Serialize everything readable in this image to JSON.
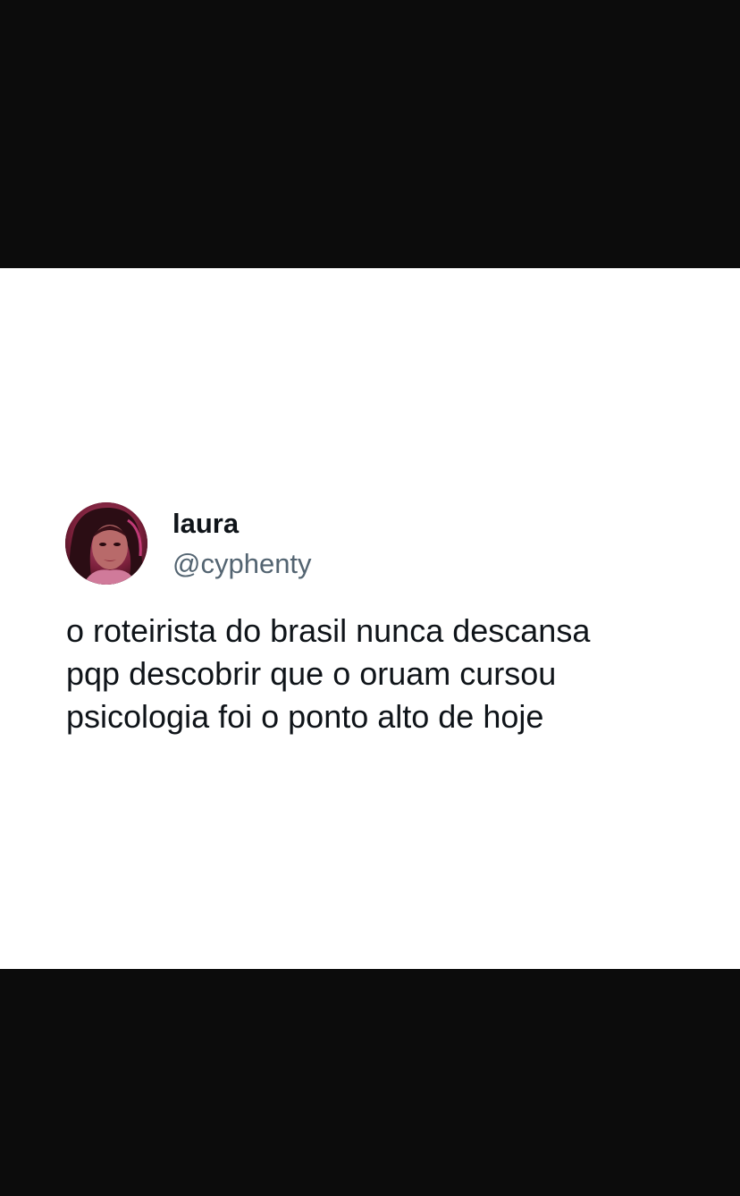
{
  "tweet": {
    "author": {
      "display_name": "laura",
      "handle": "@cyphenty",
      "avatar_icon": "profile-photo"
    },
    "text_lines": [
      "o roteirista do brasil nunca descansa",
      "pqp descobrir que o oruam cursou",
      "psicologia foi o ponto alto de hoje"
    ]
  },
  "colors": {
    "letterbox": "#0c0c0c",
    "card_background": "#ffffff",
    "primary_text": "#0f1419",
    "secondary_text": "#536471"
  }
}
